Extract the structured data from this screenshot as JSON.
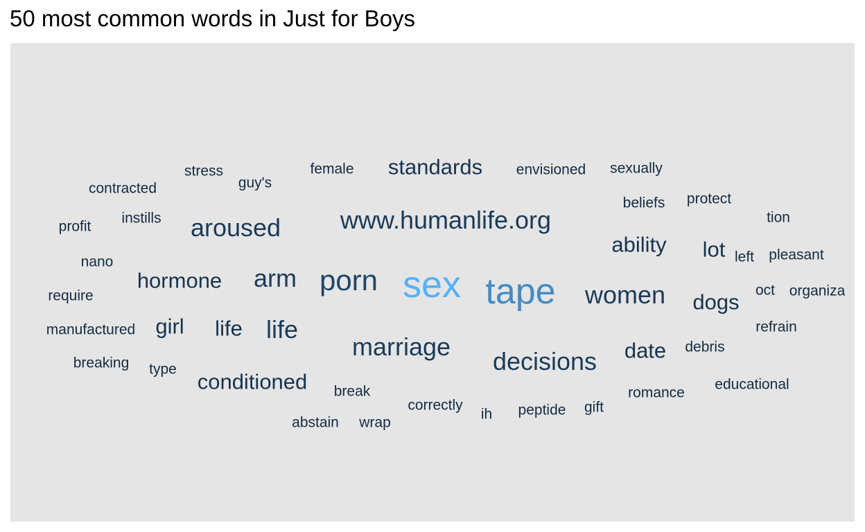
{
  "chart_data": {
    "type": "wordcloud",
    "title": "50 most common words in Just for Boys",
    "colors": {
      "low": "#132b43",
      "high": "#56b1f7",
      "background": "#e5e5e5"
    },
    "words": [
      {
        "word": "sex",
        "size": 10
      },
      {
        "word": "tape",
        "size": 9
      },
      {
        "word": "porn",
        "size": 6
      },
      {
        "word": "www.humanlife.org",
        "size": 5
      },
      {
        "word": "marriage",
        "size": 5
      },
      {
        "word": "decisions",
        "size": 5
      },
      {
        "word": "women",
        "size": 5
      },
      {
        "word": "arm",
        "size": 5
      },
      {
        "word": "aroused",
        "size": 5
      },
      {
        "word": "life",
        "size": 5
      },
      {
        "word": "conditioned",
        "size": 4
      },
      {
        "word": "hormone",
        "size": 4
      },
      {
        "word": "ability",
        "size": 4
      },
      {
        "word": "lot",
        "size": 4
      },
      {
        "word": "dogs",
        "size": 4
      },
      {
        "word": "date",
        "size": 4
      },
      {
        "word": "standards",
        "size": 4
      },
      {
        "word": "girl",
        "size": 4
      },
      {
        "word": "life",
        "size": 4
      },
      {
        "word": "stress",
        "size": 2
      },
      {
        "word": "guy's",
        "size": 2
      },
      {
        "word": "female",
        "size": 2
      },
      {
        "word": "envisioned",
        "size": 2
      },
      {
        "word": "sexually",
        "size": 2
      },
      {
        "word": "contracted",
        "size": 2
      },
      {
        "word": "beliefs",
        "size": 2
      },
      {
        "word": "protect",
        "size": 2
      },
      {
        "word": "profit",
        "size": 2
      },
      {
        "word": "instills",
        "size": 2
      },
      {
        "word": "tion",
        "size": 2
      },
      {
        "word": "nano",
        "size": 2
      },
      {
        "word": "left",
        "size": 2
      },
      {
        "word": "pleasant",
        "size": 2
      },
      {
        "word": "require",
        "size": 2
      },
      {
        "word": "oct",
        "size": 2
      },
      {
        "word": "organiza",
        "size": 2
      },
      {
        "word": "manufactured",
        "size": 2
      },
      {
        "word": "refrain",
        "size": 2
      },
      {
        "word": "breaking",
        "size": 2
      },
      {
        "word": "type",
        "size": 2
      },
      {
        "word": "debris",
        "size": 2
      },
      {
        "word": "break",
        "size": 2
      },
      {
        "word": "romance",
        "size": 2
      },
      {
        "word": "educational",
        "size": 2
      },
      {
        "word": "correctly",
        "size": 2
      },
      {
        "word": "gift",
        "size": 2
      },
      {
        "word": "ih",
        "size": 2
      },
      {
        "word": "peptide",
        "size": 2
      },
      {
        "word": "abstain",
        "size": 2
      },
      {
        "word": "wrap",
        "size": 2
      }
    ]
  }
}
